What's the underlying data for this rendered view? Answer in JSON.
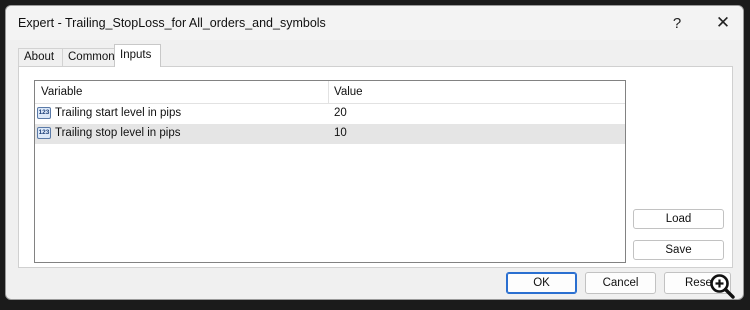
{
  "window": {
    "title": "Expert - Trailing_StopLoss_for All_orders_and_symbols",
    "help_label": "?",
    "close_label": "✕"
  },
  "tabs": [
    {
      "label": "About"
    },
    {
      "label": "Common"
    },
    {
      "label": "Inputs",
      "active": true
    }
  ],
  "inputs_table": {
    "columns": {
      "variable": "Variable",
      "value": "Value"
    },
    "rows": [
      {
        "icon": "number-param-icon",
        "icon_text": "123",
        "name": "Trailing start level in pips",
        "value": "20"
      },
      {
        "icon": "number-param-icon",
        "icon_text": "123",
        "name": "Trailing stop level in pips",
        "value": "10",
        "selected": true
      }
    ]
  },
  "side_buttons": {
    "load": "Load",
    "save": "Save"
  },
  "footer": {
    "ok": "OK",
    "cancel": "Cancel",
    "reset": "Rese"
  },
  "icons": {
    "magnifier": "zoom-in-icon"
  },
  "colors": {
    "ok_border": "#2a6fd0",
    "selection": "#e5e5e5",
    "dialog_bg": "#f0f0f0"
  }
}
